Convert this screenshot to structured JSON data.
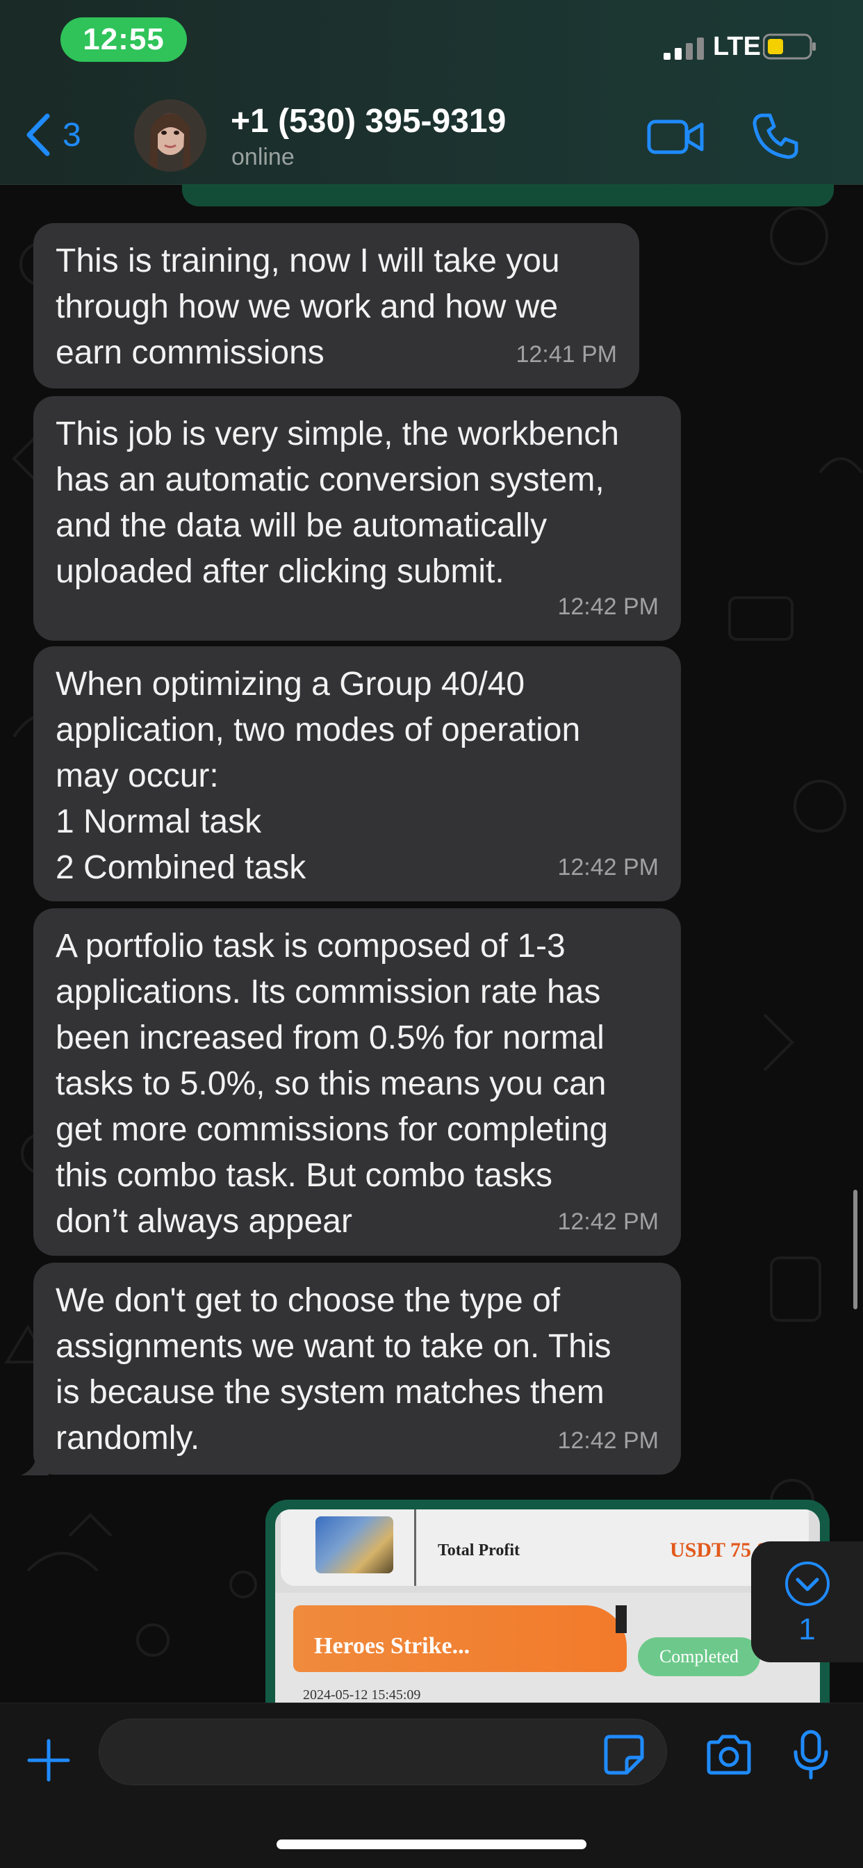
{
  "status_bar": {
    "time": "12:55",
    "network": "LTE",
    "time_pill_color": "#2fc35a",
    "battery_level_color": "#f5d000"
  },
  "header": {
    "back_count": "3",
    "contact_name": "+1 (530) 395-9319",
    "contact_status": "online",
    "accent_color": "#1f8bff"
  },
  "messages": [
    {
      "text": "This is training, now I will take you\nthrough how we work and how we\nearn commissions",
      "time": "12:41 PM"
    },
    {
      "text": "This job is very simple, the workbench\nhas an automatic conversion system,\nand the data will be automatically\nuploaded after clicking submit.",
      "time": "12:42 PM"
    },
    {
      "text": "When optimizing a Group 40/40\napplication, two modes of operation\nmay occur:\n1 Normal task\n2 Combined task",
      "time": "12:42 PM"
    },
    {
      "text": "A portfolio task is composed of 1-3\napplications. Its commission rate has\nbeen increased from 0.5% for normal\ntasks to 5.0%, so this means you can\nget more commissions for completing\nthis combo task. But combo tasks\ndon’t always appear",
      "time": "12:42 PM"
    },
    {
      "text": "We don't get to choose the type of\nassignments we want to take on. This\nis because the system matches them\nrandomly.",
      "time": "12:42 PM"
    }
  ],
  "image_message": {
    "total_profit_label": "Total Profit",
    "amount": "USDT 75.00",
    "game_title": "Heroes Strike...",
    "status_badge": "Completed",
    "date": "2024-05-12 15:45:09"
  },
  "scroll_down": {
    "unread_count": "1"
  },
  "input": {
    "placeholder": ""
  }
}
